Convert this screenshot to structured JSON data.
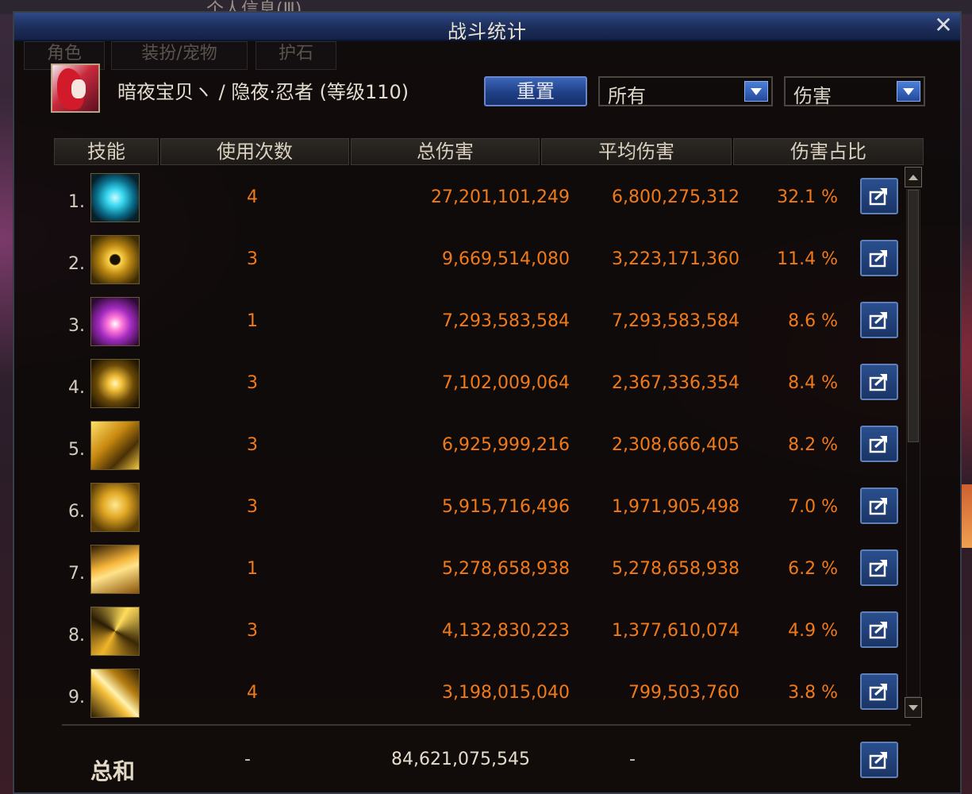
{
  "window": {
    "title": "战斗统计",
    "close_glyph": "✕"
  },
  "background": {
    "top_text": "个人信息(Ⅲ)",
    "tabs": [
      "角色",
      "装扮/宠物",
      "护石"
    ]
  },
  "character": {
    "label": "暗夜宝贝ヽ / 隐夜·忍者 (等级110)"
  },
  "controls": {
    "reset_label": "重置",
    "filter_value": "所有",
    "metric_value": "伤害"
  },
  "table": {
    "headers": [
      "技能",
      "使用次数",
      "总伤害",
      "平均伤害",
      "伤害占比"
    ],
    "rows": [
      {
        "rank": "1.",
        "uses": "4",
        "total": "27,201,101,249",
        "avg": "6,800,275,312",
        "pct": "32.1 %",
        "icon": "cyan-orb-icon"
      },
      {
        "rank": "2.",
        "uses": "3",
        "total": "9,669,514,080",
        "avg": "3,223,171,360",
        "pct": "11.4 %",
        "icon": "golden-eye-icon"
      },
      {
        "rank": "3.",
        "uses": "1",
        "total": "7,293,583,584",
        "avg": "7,293,583,584",
        "pct": "8.6 %",
        "icon": "purple-burst-icon"
      },
      {
        "rank": "4.",
        "uses": "3",
        "total": "7,102,009,064",
        "avg": "2,367,336,354",
        "pct": "8.4 %",
        "icon": "golden-cross-slash-icon"
      },
      {
        "rank": "5.",
        "uses": "3",
        "total": "6,925,999,216",
        "avg": "2,308,666,405",
        "pct": "8.2 %",
        "icon": "golden-dragon-icon"
      },
      {
        "rank": "6.",
        "uses": "3",
        "total": "5,915,716,496",
        "avg": "1,971,905,498",
        "pct": "7.0 %",
        "icon": "golden-lion-icon"
      },
      {
        "rank": "7.",
        "uses": "1",
        "total": "5,278,658,938",
        "avg": "5,278,658,938",
        "pct": "6.2 %",
        "icon": "golden-flame-icon"
      },
      {
        "rank": "8.",
        "uses": "3",
        "total": "4,132,830,223",
        "avg": "1,377,610,074",
        "pct": "4.9 %",
        "icon": "golden-spiral-icon"
      },
      {
        "rank": "9.",
        "uses": "4",
        "total": "3,198,015,040",
        "avg": "799,503,760",
        "pct": "3.8 %",
        "icon": "golden-kunai-icon"
      }
    ]
  },
  "footer": {
    "label": "总和",
    "uses": "-",
    "total": "84,621,075,545",
    "avg": "-"
  },
  "colors": {
    "accent_orange": "#f07a1a",
    "title_blue": "#2f4a86",
    "button_blue": "#1f3f86"
  }
}
